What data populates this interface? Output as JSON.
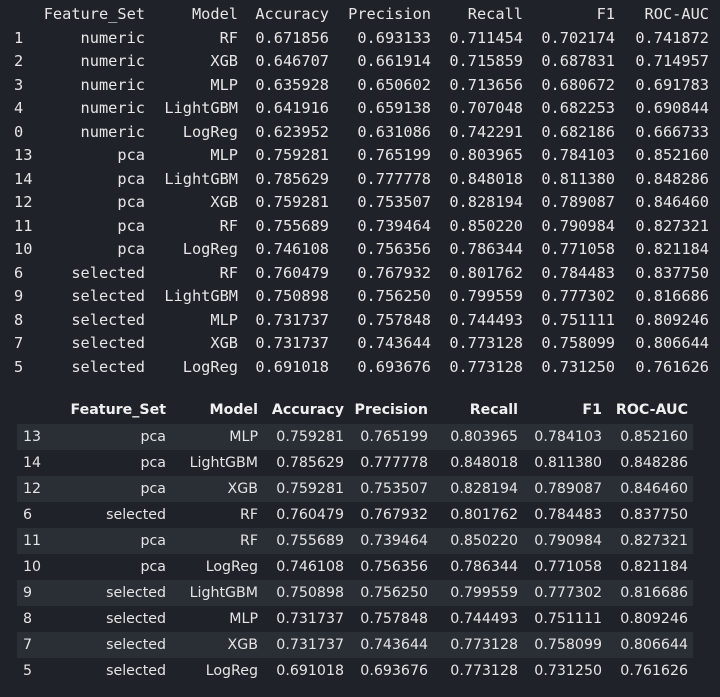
{
  "text_output": {
    "headers": [
      "",
      "Feature_Set",
      "Model",
      "Accuracy",
      "Precision",
      "Recall",
      "F1",
      "ROC-AUC"
    ],
    "rows": [
      [
        "1",
        "numeric",
        "RF",
        "0.671856",
        "0.693133",
        "0.711454",
        "0.702174",
        "0.741872"
      ],
      [
        "2",
        "numeric",
        "XGB",
        "0.646707",
        "0.661914",
        "0.715859",
        "0.687831",
        "0.714957"
      ],
      [
        "3",
        "numeric",
        "MLP",
        "0.635928",
        "0.650602",
        "0.713656",
        "0.680672",
        "0.691783"
      ],
      [
        "4",
        "numeric",
        "LightGBM",
        "0.641916",
        "0.659138",
        "0.707048",
        "0.682253",
        "0.690844"
      ],
      [
        "0",
        "numeric",
        "LogReg",
        "0.623952",
        "0.631086",
        "0.742291",
        "0.682186",
        "0.666733"
      ],
      [
        "13",
        "pca",
        "MLP",
        "0.759281",
        "0.765199",
        "0.803965",
        "0.784103",
        "0.852160"
      ],
      [
        "14",
        "pca",
        "LightGBM",
        "0.785629",
        "0.777778",
        "0.848018",
        "0.811380",
        "0.848286"
      ],
      [
        "12",
        "pca",
        "XGB",
        "0.759281",
        "0.753507",
        "0.828194",
        "0.789087",
        "0.846460"
      ],
      [
        "11",
        "pca",
        "RF",
        "0.755689",
        "0.739464",
        "0.850220",
        "0.790984",
        "0.827321"
      ],
      [
        "10",
        "pca",
        "LogReg",
        "0.746108",
        "0.756356",
        "0.786344",
        "0.771058",
        "0.821184"
      ],
      [
        "6",
        "selected",
        "RF",
        "0.760479",
        "0.767932",
        "0.801762",
        "0.784483",
        "0.837750"
      ],
      [
        "9",
        "selected",
        "LightGBM",
        "0.750898",
        "0.756250",
        "0.799559",
        "0.777302",
        "0.816686"
      ],
      [
        "8",
        "selected",
        "MLP",
        "0.731737",
        "0.757848",
        "0.744493",
        "0.751111",
        "0.809246"
      ],
      [
        "7",
        "selected",
        "XGB",
        "0.731737",
        "0.743644",
        "0.773128",
        "0.758099",
        "0.806644"
      ],
      [
        "5",
        "selected",
        "LogReg",
        "0.691018",
        "0.693676",
        "0.773128",
        "0.731250",
        "0.761626"
      ]
    ]
  },
  "dataframe": {
    "headers": [
      "",
      "Feature_Set",
      "Model",
      "Accuracy",
      "Precision",
      "Recall",
      "F1",
      "ROC-AUC"
    ],
    "rows": [
      [
        "13",
        "pca",
        "MLP",
        "0.759281",
        "0.765199",
        "0.803965",
        "0.784103",
        "0.852160"
      ],
      [
        "14",
        "pca",
        "LightGBM",
        "0.785629",
        "0.777778",
        "0.848018",
        "0.811380",
        "0.848286"
      ],
      [
        "12",
        "pca",
        "XGB",
        "0.759281",
        "0.753507",
        "0.828194",
        "0.789087",
        "0.846460"
      ],
      [
        "6",
        "selected",
        "RF",
        "0.760479",
        "0.767932",
        "0.801762",
        "0.784483",
        "0.837750"
      ],
      [
        "11",
        "pca",
        "RF",
        "0.755689",
        "0.739464",
        "0.850220",
        "0.790984",
        "0.827321"
      ],
      [
        "10",
        "pca",
        "LogReg",
        "0.746108",
        "0.756356",
        "0.786344",
        "0.771058",
        "0.821184"
      ],
      [
        "9",
        "selected",
        "LightGBM",
        "0.750898",
        "0.756250",
        "0.799559",
        "0.777302",
        "0.816686"
      ],
      [
        "8",
        "selected",
        "MLP",
        "0.731737",
        "0.757848",
        "0.744493",
        "0.751111",
        "0.809246"
      ],
      [
        "7",
        "selected",
        "XGB",
        "0.731737",
        "0.743644",
        "0.773128",
        "0.758099",
        "0.806644"
      ],
      [
        "5",
        "selected",
        "LogReg",
        "0.691018",
        "0.693676",
        "0.773128",
        "0.731250",
        "0.761626"
      ]
    ]
  }
}
